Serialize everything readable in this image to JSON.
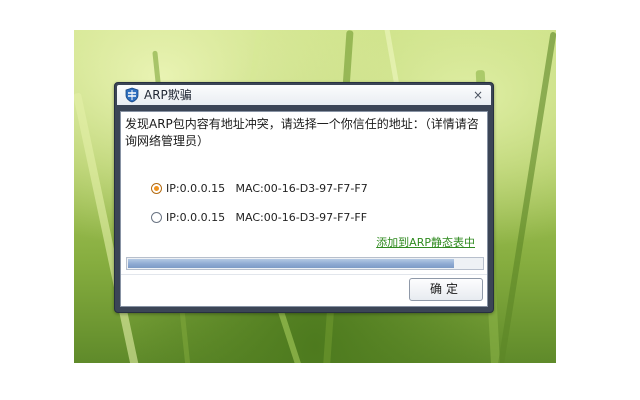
{
  "window": {
    "title": "ARP欺骗",
    "close_glyph": "×",
    "icon": "shield-icon"
  },
  "message": "发现ARP包内容有地址冲突，请选择一个你信任的地址：（详情请咨询网络管理员）",
  "options": [
    {
      "label": "IP:0.0.0.15   MAC:00-16-D3-97-F7-F7",
      "checked": true
    },
    {
      "label": "IP:0.0.0.15   MAC:00-16-D3-97-F7-FF",
      "checked": false
    }
  ],
  "add_link": "添加到ARP静态表中",
  "progress_fraction": 0.92,
  "ok_label": "确定",
  "colors": {
    "accent_link": "#2f8a1f",
    "radio_selected": "#f0931f",
    "window_frame": "#3b4556"
  }
}
